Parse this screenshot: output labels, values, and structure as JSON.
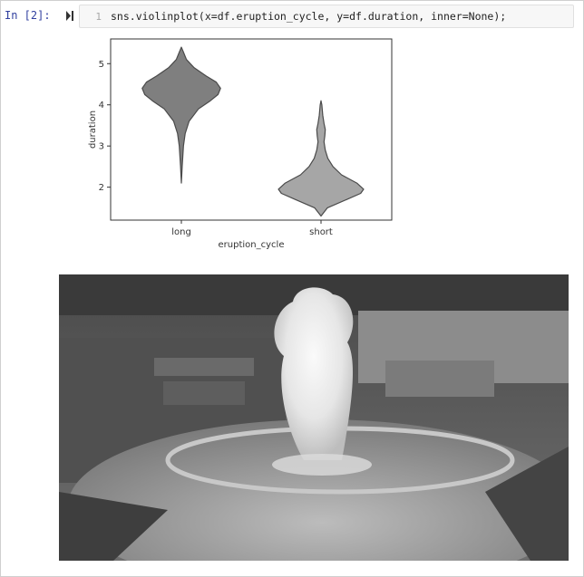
{
  "cell": {
    "prompt": "In [2]:",
    "line_number": "1",
    "code": "sns.violinplot(x=df.eruption_cycle, y=df.duration, inner=None);"
  },
  "chart_data": {
    "type": "violin",
    "categories": [
      "long",
      "short"
    ],
    "xlabel": "eruption_cycle",
    "ylabel": "duration",
    "y_ticks": [
      2,
      3,
      4,
      5
    ],
    "ylim": [
      1.2,
      5.6
    ],
    "violin_color": "#808080",
    "series": [
      {
        "category": "long",
        "min": 2.1,
        "max": 5.4,
        "density_profile": [
          [
            2.1,
            0.0
          ],
          [
            2.5,
            0.02
          ],
          [
            3.0,
            0.05
          ],
          [
            3.3,
            0.09
          ],
          [
            3.6,
            0.18
          ],
          [
            3.9,
            0.4
          ],
          [
            4.1,
            0.68
          ],
          [
            4.25,
            0.86
          ],
          [
            4.4,
            0.92
          ],
          [
            4.55,
            0.82
          ],
          [
            4.7,
            0.58
          ],
          [
            4.9,
            0.3
          ],
          [
            5.1,
            0.12
          ],
          [
            5.3,
            0.04
          ],
          [
            5.4,
            0.0
          ]
        ]
      },
      {
        "category": "short",
        "min": 1.3,
        "max": 4.1,
        "density_profile": [
          [
            1.3,
            0.0
          ],
          [
            1.5,
            0.15
          ],
          [
            1.7,
            0.6
          ],
          [
            1.85,
            0.93
          ],
          [
            1.95,
            1.0
          ],
          [
            2.1,
            0.84
          ],
          [
            2.3,
            0.48
          ],
          [
            2.5,
            0.28
          ],
          [
            2.7,
            0.16
          ],
          [
            2.9,
            0.1
          ],
          [
            3.1,
            0.07
          ],
          [
            3.25,
            0.09
          ],
          [
            3.4,
            0.1
          ],
          [
            3.55,
            0.07
          ],
          [
            3.75,
            0.04
          ],
          [
            4.0,
            0.02
          ],
          [
            4.1,
            0.0
          ]
        ]
      }
    ]
  },
  "image": {
    "subject": "geyser-photo"
  }
}
